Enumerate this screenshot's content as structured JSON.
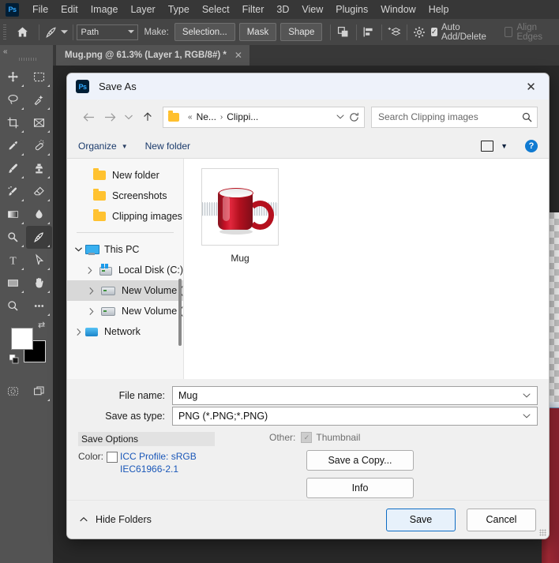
{
  "app": {
    "name": "Photoshop",
    "logo_text": "Ps",
    "menu": [
      "File",
      "Edit",
      "Image",
      "Layer",
      "Type",
      "Select",
      "Filter",
      "3D",
      "View",
      "Plugins",
      "Window",
      "Help"
    ]
  },
  "options_bar": {
    "home_icon": "home-icon",
    "tool_icon": "pen-tool-icon",
    "mode_select": "Path",
    "make_label": "Make:",
    "selection_button": "Selection...",
    "mask_button": "Mask",
    "shape_button": "Shape",
    "path_operations_icon": "path-operations-icon",
    "path_alignment_icon": "path-alignment-icon",
    "path_arrangement_icon": "path-arrangement-icon",
    "settings_icon": "gear-icon",
    "auto_add_delete": {
      "label": "Auto Add/Delete",
      "checked": true
    },
    "align_edges": {
      "label": "Align Edges",
      "checked": false,
      "disabled": true
    }
  },
  "document_tab": {
    "title": "Mug.png @ 61.3% (Layer 1, RGB/8#) *",
    "close_icon": "close-icon"
  },
  "tools": [
    {
      "name": "move-tool",
      "glyph": "move"
    },
    {
      "name": "rectangular-marquee-tool",
      "glyph": "marquee"
    },
    {
      "name": "lasso-tool",
      "glyph": "lasso"
    },
    {
      "name": "object-selection-tool",
      "glyph": "wand"
    },
    {
      "name": "crop-tool",
      "glyph": "crop"
    },
    {
      "name": "frame-tool",
      "glyph": "frame"
    },
    {
      "name": "eyedropper-tool",
      "glyph": "eyedropper"
    },
    {
      "name": "spot-healing-brush-tool",
      "glyph": "healing"
    },
    {
      "name": "brush-tool",
      "glyph": "brush"
    },
    {
      "name": "clone-stamp-tool",
      "glyph": "stamp"
    },
    {
      "name": "history-brush-tool",
      "glyph": "historybrush"
    },
    {
      "name": "eraser-tool",
      "glyph": "eraser"
    },
    {
      "name": "gradient-tool",
      "glyph": "gradient"
    },
    {
      "name": "blur-tool",
      "glyph": "blur"
    },
    {
      "name": "dodge-tool",
      "glyph": "dodge"
    },
    {
      "name": "pen-tool",
      "glyph": "pen",
      "selected": true
    },
    {
      "name": "type-tool",
      "glyph": "type"
    },
    {
      "name": "path-selection-tool",
      "glyph": "arrow"
    },
    {
      "name": "rectangle-tool",
      "glyph": "rectangle"
    },
    {
      "name": "hand-tool",
      "glyph": "hand"
    },
    {
      "name": "zoom-tool",
      "glyph": "zoom"
    },
    {
      "name": "edit-toolbar-tool",
      "glyph": "ellipsis"
    }
  ],
  "tools_bottom": [
    {
      "name": "quick-mask-toggle",
      "glyph": "quickmask"
    },
    {
      "name": "screen-mode-toggle",
      "glyph": "screenmode"
    }
  ],
  "color_swatches": {
    "foreground": "#ffffff",
    "background": "#000000",
    "swap_icon": "swap-colors-icon",
    "default_icon": "default-colors-icon"
  },
  "dialog": {
    "title": "Save As",
    "logo_text": "Ps",
    "close_icon": "close-icon",
    "nav": {
      "back_icon": "arrow-left-icon",
      "forward_icon": "arrow-right-icon",
      "recent_icon": "chevron-down-icon",
      "up_icon": "arrow-up-icon",
      "breadcrumb": {
        "folder_icon": "folder-icon",
        "overflow": "«",
        "parts": [
          "Ne...",
          "Clippi..."
        ],
        "separator": "›",
        "dropdown_icon": "chevron-down-icon"
      },
      "refresh_icon": "refresh-icon",
      "search": {
        "placeholder": "Search Clipping images",
        "value": "",
        "icon": "search-icon"
      }
    },
    "commands": {
      "organize": "Organize",
      "new_folder": "New folder",
      "view_icon": "view-layout-icon",
      "view_caret_icon": "chevron-down-icon",
      "help_icon": "help-icon",
      "help_text": "?"
    },
    "nav_pane": {
      "quick_access": [
        {
          "label": "New folder",
          "icon": "folder-icon"
        },
        {
          "label": "Screenshots",
          "icon": "folder-icon"
        },
        {
          "label": "Clipping images",
          "icon": "folder-icon"
        }
      ],
      "tree": [
        {
          "label": "This PC",
          "icon": "this-pc-icon",
          "expanded": true,
          "indent": 0,
          "selected": false
        },
        {
          "label": "Local Disk (C:)",
          "icon": "windows-drive-icon",
          "expanded": false,
          "indent": 1,
          "selected": false
        },
        {
          "label": "New Volume (",
          "icon": "drive-icon",
          "expanded": false,
          "indent": 1,
          "selected": true
        },
        {
          "label": "New Volume (",
          "icon": "drive-icon",
          "expanded": false,
          "indent": 1,
          "selected": false
        },
        {
          "label": "Network",
          "icon": "network-icon",
          "expanded": false,
          "indent": 0,
          "selected": false
        }
      ]
    },
    "files": [
      {
        "name": "Mug",
        "thumbnail": "red-coffee-mug-image"
      }
    ],
    "fields": {
      "file_name_label": "File name:",
      "file_name_value": "Mug",
      "save_as_type_label": "Save as type:",
      "save_as_type_value": "PNG (*.PNG;*.PNG)",
      "dropdown_icon": "chevron-down-icon"
    },
    "save_options": {
      "header": "Save Options",
      "color_label": "Color:",
      "icc_checked": false,
      "icc_line1": "ICC Profile:  sRGB",
      "icc_line2": "IEC61966-2.1",
      "icc_link_color": "#1a57b8",
      "other_label": "Other:",
      "thumbnail_label": "Thumbnail",
      "thumbnail_checked": true,
      "thumbnail_disabled": true,
      "save_a_copy_button": "Save a Copy...",
      "info_button": "Info"
    },
    "footer": {
      "hide_folders": "Hide Folders",
      "hide_folders_icon": "chevron-up-icon",
      "save_button": "Save",
      "cancel_button": "Cancel",
      "resize_grip": "resize-grip-icon"
    }
  },
  "colors": {
    "ps_dark": "#535353",
    "ps_menubar": "#373737",
    "accent_blue": "#0d6cc4",
    "folder_yellow": "#ffc230",
    "mug_red": "#c51126"
  }
}
